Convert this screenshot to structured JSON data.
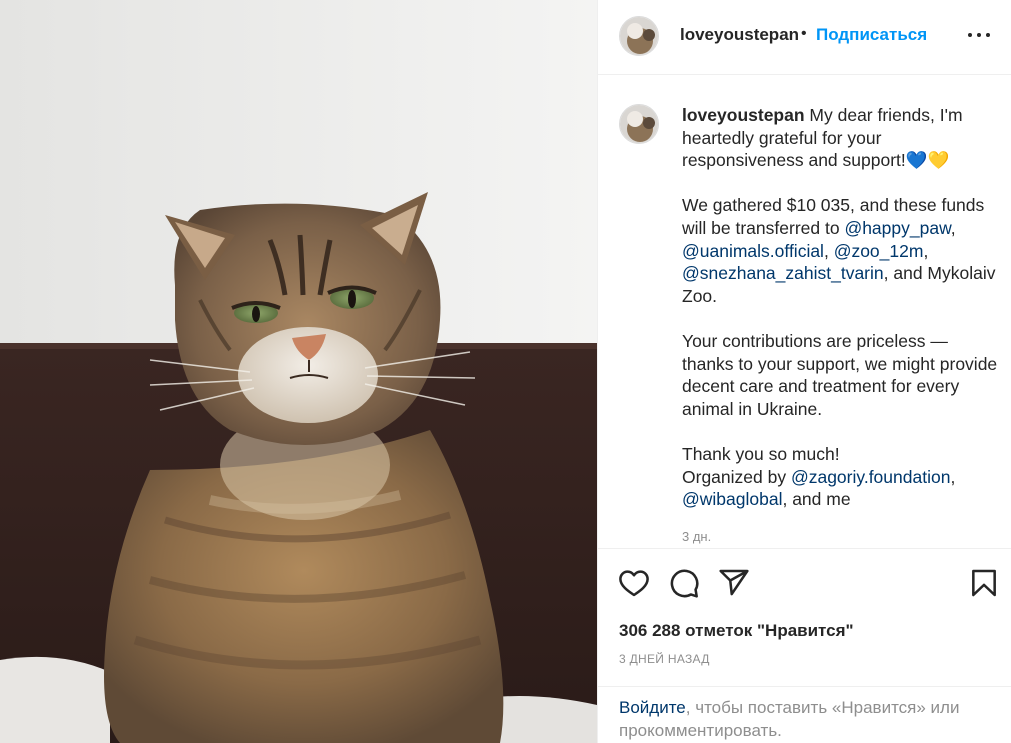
{
  "post": {
    "username": "loveyoustepan",
    "dot": "•",
    "follow_label": "Подписаться",
    "more_icon": "more-horizontal-icon",
    "caption": {
      "line1_text": " My dear friends, I'm heartedly grateful for your responsiveness and support!",
      "emoji": "💙💛",
      "p2_text": "We gathered $10 035, and these funds will be transferred to ",
      "mention_happy_paw": "@happy_paw",
      "sep1": ", ",
      "mention_uanimals": "@uanimals.official",
      "sep2": ", ",
      "mention_zoo": "@zoo_12m",
      "sep3": ", ",
      "mention_snezhana": "@snezhana_zahist_tvarin",
      "p2_tail": ", and Mykolaiv Zoo.",
      "p3": "Your contributions are priceless — thanks to your support, we might provide decent care and treatment for every animal in Ukraine.",
      "p4_line1": "Thank you so much!",
      "p4_line2_text": "Organized by ",
      "mention_zagoriy": "@zagoriy.foundation",
      "sep4": ", ",
      "mention_wiba": "@wibaglobal",
      "p4_tail": ", and me"
    },
    "caption_time": "3 дн.",
    "likes": "306 288 отметок \"Нравится\"",
    "date": "3 ДНЕЙ НАЗАД",
    "login": {
      "link": "Войдите",
      "text": ", чтобы поставить «Нравится» или прокомментировать."
    },
    "icons": [
      "heart-icon",
      "comment-icon",
      "share-icon",
      "bookmark-icon"
    ],
    "colors": {
      "accent": "#0095f6",
      "mention": "#00376b",
      "muted": "#8e8e8e",
      "text": "#262626"
    }
  }
}
